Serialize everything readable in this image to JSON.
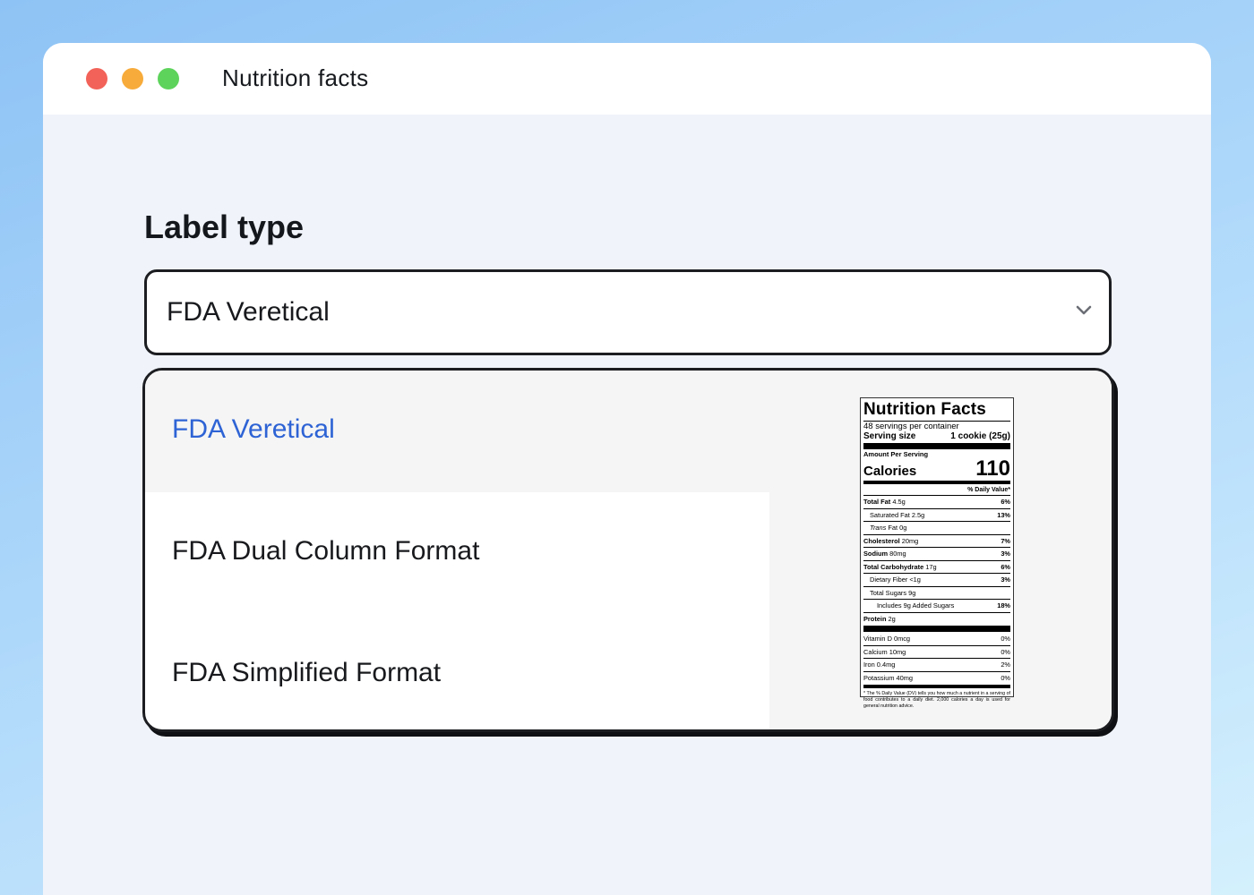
{
  "window": {
    "title": "Nutrition facts"
  },
  "form": {
    "label": "Label type",
    "selected_value": "FDA Veretical",
    "options": [
      {
        "label": "FDA Veretical",
        "selected": true
      },
      {
        "label": "FDA Dual Column Format",
        "selected": false
      },
      {
        "label": "FDA Simplified Format",
        "selected": false
      }
    ]
  },
  "nutrition_label": {
    "title": "Nutrition Facts",
    "servings": "48 servings per container",
    "serving_size_label": "Serving size",
    "serving_size_value": "1 cookie (25g)",
    "amount_per_serving": "Amount Per Serving",
    "calories_label": "Calories",
    "calories_value": "110",
    "dv_header": "% Daily Value*",
    "rows": {
      "total_fat": {
        "name": "Total Fat",
        "amount": "4.5g",
        "dv": "6%"
      },
      "saturated_fat": {
        "name": "Saturated Fat 2.5g",
        "dv": "13%"
      },
      "trans_fat_italic": "Trans",
      "trans_fat_rest": "Fat 0g",
      "cholesterol": {
        "name": "Cholesterol",
        "amount": "20mg",
        "dv": "7%"
      },
      "sodium": {
        "name": "Sodium",
        "amount": "80mg",
        "dv": "3%"
      },
      "total_carb": {
        "name": "Total Carbohydrate",
        "amount": "17g",
        "dv": "6%"
      },
      "dietary_fiber": {
        "name": "Dietary Fiber <1g",
        "dv": "3%"
      },
      "total_sugars": {
        "name": "Total Sugars 9g"
      },
      "added_sugars": {
        "name": "Includes 9g Added Sugars",
        "dv": "18%"
      },
      "protein": {
        "name": "Protein",
        "amount": "2g"
      }
    },
    "vitamins": [
      {
        "name": "Vitamin D 0mcg",
        "dv": "0%"
      },
      {
        "name": "Calcium 10mg",
        "dv": "0%"
      },
      {
        "name": "Iron 0.4mg",
        "dv": "2%"
      },
      {
        "name": "Potassium 40mg",
        "dv": "0%"
      }
    ],
    "footnote": "* The % Daily Value (DV) tells you how much a nutrient in a serving of food contributes to a daily diet. 2,000 calories a day is used for general nutrition advice."
  },
  "colors": {
    "accent_selected": "#2d63d4",
    "close": "#f26258",
    "minimize": "#f7ab3a",
    "maximize": "#5dd35b"
  },
  "icons": {
    "select_indicator": "chevron-down-icon"
  }
}
